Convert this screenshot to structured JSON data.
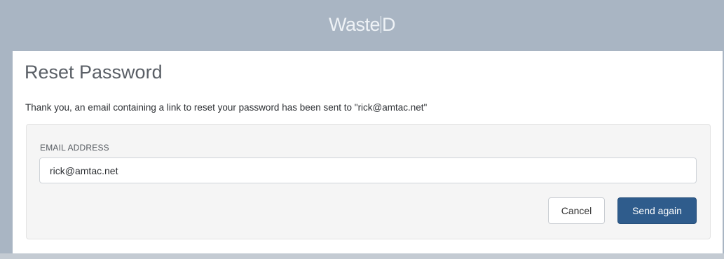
{
  "header": {
    "brand_pre": "Waste",
    "brand_post": "D"
  },
  "card": {
    "title": "Reset Password",
    "message": "Thank you, an email containing a link to reset your password has been sent to \"rick@amtac.net\""
  },
  "form": {
    "email_label": "EMAIL ADDRESS",
    "email_value": "rick@amtac.net",
    "cancel_label": "Cancel",
    "send_label": "Send again"
  },
  "colors": {
    "header_bg": "#a9b5c3",
    "primary_button": "#2f5c8c"
  }
}
